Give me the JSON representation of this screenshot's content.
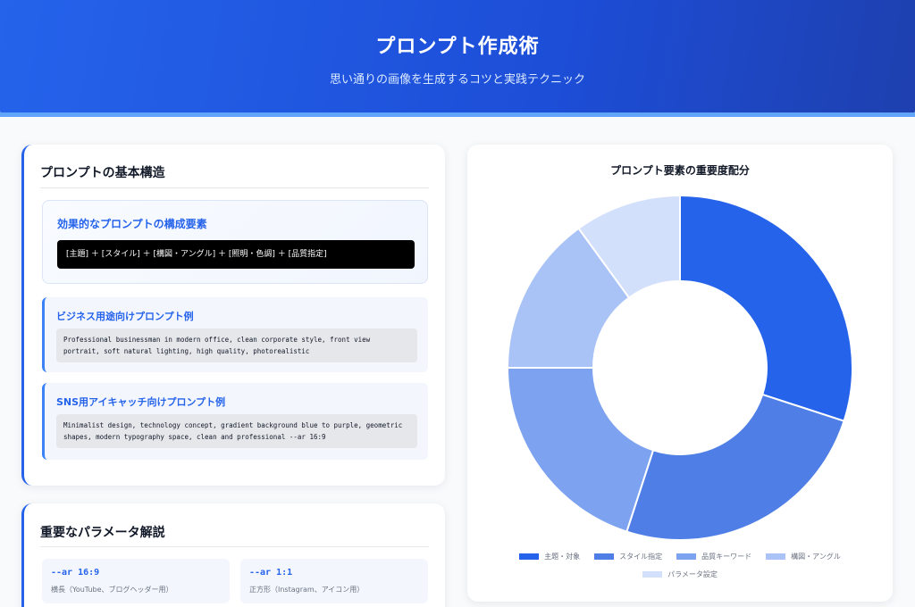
{
  "header": {
    "title": "プロンプト作成術",
    "subtitle": "思い通りの画像を生成するコツと実践テクニック"
  },
  "structure_card": {
    "title": "プロンプトの基本構造",
    "formula": {
      "title": "効果的なプロンプトの構成要素",
      "code": "[主題] ＋ [スタイル] ＋ [構図・アングル] ＋ [照明・色調] ＋ [品質指定]"
    },
    "examples": [
      {
        "title": "ビジネス用途向けプロンプト例",
        "code": "Professional businessman in modern office, clean corporate style, front view portrait, soft natural lighting, high quality, photorealistic"
      },
      {
        "title": "SNS用アイキャッチ向けプロンプト例",
        "code": "Minimalist design, technology concept, gradient background blue to purple, geometric shapes, modern typography space, clean and professional --ar 16:9"
      }
    ]
  },
  "params_card": {
    "title": "重要なパラメータ解説",
    "params": [
      {
        "name": "--ar 16:9",
        "desc": "横長（YouTube、ブログヘッダー用）"
      },
      {
        "name": "--ar 1:1",
        "desc": "正方形（Instagram、アイコン用）"
      }
    ]
  },
  "chart_data": {
    "type": "pie",
    "variant": "doughnut",
    "title": "プロンプト要素の重要度配分",
    "categories": [
      "主題・対象",
      "スタイル指定",
      "品質キーワード",
      "構図・アングル",
      "パラメータ設定"
    ],
    "values": [
      30,
      25,
      20,
      15,
      10
    ],
    "colors": [
      "#2563eb",
      "#4f7fe6",
      "#7da2f0",
      "#a9c3f6",
      "#d3e0fb"
    ],
    "legend_position": "bottom"
  }
}
